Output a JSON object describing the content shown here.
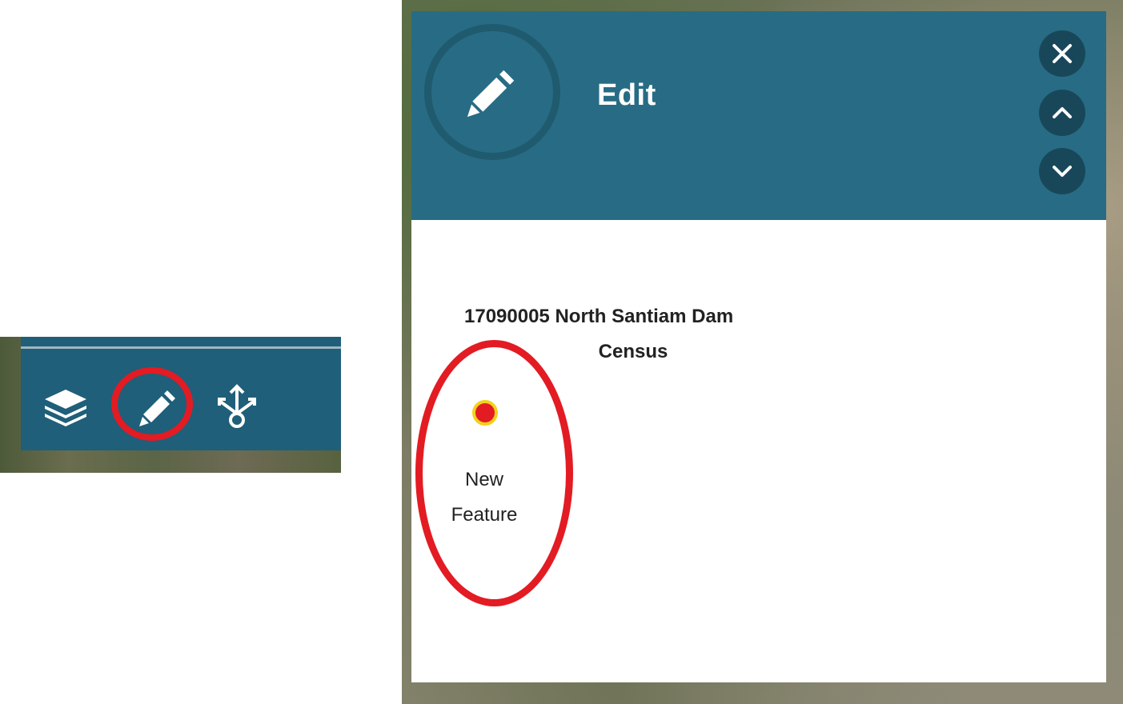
{
  "toolbar": {
    "tools": [
      {
        "icon": "layers-icon"
      },
      {
        "icon": "pencil-icon"
      },
      {
        "icon": "share-icon"
      }
    ]
  },
  "edit_panel": {
    "header_icon": "pencil-icon",
    "title": "Edit",
    "controls": [
      {
        "icon": "close-icon"
      },
      {
        "icon": "chevron-up-icon"
      },
      {
        "icon": "chevron-down-icon"
      }
    ],
    "layer": {
      "title_line1": "17090005 North Santiam Dam",
      "title_line2": "Census"
    },
    "template": {
      "label_line1": "New",
      "label_line2": "Feature",
      "symbol_fill": "#e31b23",
      "symbol_outline": "#f2d21b"
    }
  },
  "colors": {
    "header": "#276c84",
    "toolbar": "#1f5f79",
    "highlight": "#e31b23",
    "button": "#19475a"
  }
}
